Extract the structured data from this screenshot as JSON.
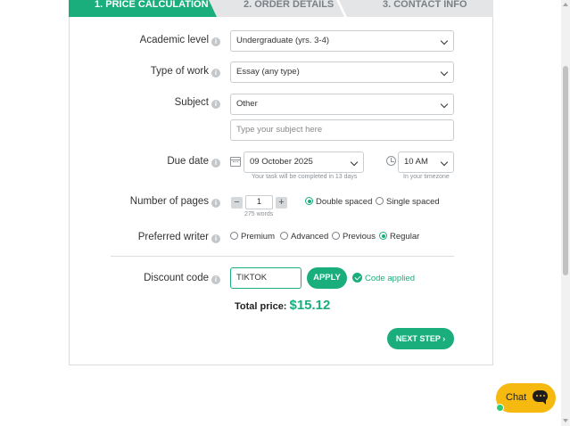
{
  "steps": [
    {
      "label": "1. PRICE CALCULATION",
      "active": true
    },
    {
      "label": "2. ORDER DETAILS",
      "active": false
    },
    {
      "label": "3. CONTACT INFO",
      "active": false
    }
  ],
  "form": {
    "academic_level": {
      "label": "Academic level",
      "value": "Undergraduate (yrs. 3-4)"
    },
    "type_of_work": {
      "label": "Type of work",
      "value": "Essay (any type)"
    },
    "subject": {
      "label": "Subject",
      "value": "Other",
      "placeholder": "Type your subject here"
    },
    "due_date": {
      "label": "Due date",
      "date": "09 October 2025",
      "time": "10 AM",
      "completion_hint": "Your task will be completed in 13 days",
      "timezone_hint": "In your timezone"
    },
    "pages": {
      "label": "Number of pages",
      "value": "1",
      "minus": "−",
      "plus": "+",
      "words_hint": "275 words",
      "spacing_options": [
        {
          "label": "Double spaced",
          "selected": true
        },
        {
          "label": "Single spaced",
          "selected": false
        }
      ]
    },
    "writer": {
      "label": "Preferred writer",
      "options": [
        {
          "label": "Premium",
          "selected": false
        },
        {
          "label": "Advanced",
          "selected": false
        },
        {
          "label": "Previous",
          "selected": false
        },
        {
          "label": "Regular",
          "selected": true
        }
      ]
    },
    "discount": {
      "label": "Discount code",
      "value": "TIKTOK",
      "apply_label": "APPLY",
      "status": "Code applied"
    },
    "total": {
      "label": "Total price:",
      "value": "$15.12"
    },
    "next_label": "NEXT STEP"
  },
  "chat": {
    "label": "Chat"
  },
  "colors": {
    "accent": "#1aae7d",
    "chat": "#f5b90f"
  },
  "icons": {
    "info": "info-icon",
    "calendar": "calendar-icon",
    "clock": "clock-icon",
    "check": "check-circle-icon",
    "chat": "chat-bubble-icon",
    "chevron": "chevron-down-icon"
  }
}
